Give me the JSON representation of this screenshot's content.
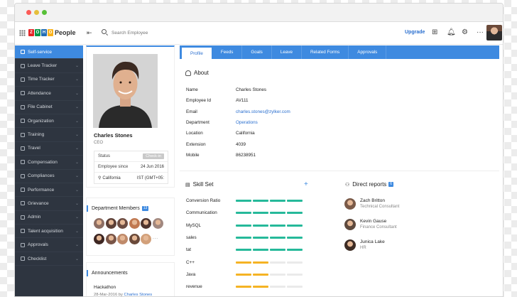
{
  "app": {
    "brand_letters": [
      "Z",
      "O",
      "H",
      "O"
    ],
    "brand_colors": [
      "#e42527",
      "#089949",
      "#226db4",
      "#f9b21d"
    ],
    "brand_word": "People",
    "accent": "#3e8ae0"
  },
  "topbar": {
    "search_placeholder": "Search Employee",
    "upgrade_label": "Upgrade",
    "icons": [
      "add-icon",
      "bell-icon",
      "gear-icon",
      "more-icon"
    ]
  },
  "sidebar": {
    "items": [
      {
        "label": "Self-service",
        "icon": "user-icon"
      },
      {
        "label": "Leave Tracker",
        "icon": "calendar-icon"
      },
      {
        "label": "Time Tracker",
        "icon": "clock-icon"
      },
      {
        "label": "Attendance",
        "icon": "attendance-icon"
      },
      {
        "label": "File Cabinet",
        "icon": "folder-icon"
      },
      {
        "label": "Organization",
        "icon": "org-icon"
      },
      {
        "label": "Training",
        "icon": "training-icon"
      },
      {
        "label": "Travel",
        "icon": "plane-icon"
      },
      {
        "label": "Compensation",
        "icon": "money-icon"
      },
      {
        "label": "Compliances",
        "icon": "shield-icon"
      },
      {
        "label": "Performance",
        "icon": "chart-icon"
      },
      {
        "label": "Grievance",
        "icon": "flag-icon"
      },
      {
        "label": "Admin",
        "icon": "admin-icon"
      },
      {
        "label": "Talent acquisition",
        "icon": "search-person-icon"
      },
      {
        "label": "Approvals",
        "icon": "check-icon"
      },
      {
        "label": "Checklist",
        "icon": "list-icon"
      }
    ]
  },
  "profile": {
    "name": "Charles Stones",
    "role": "CEO",
    "status_label": "Status",
    "checkin_label": "Check-in",
    "employee_since_label": "Employee since",
    "employee_since_value": "24 Jun 2016",
    "location": "California",
    "timezone": "IST (GMT+05:"
  },
  "members": {
    "title": "Department Members",
    "count": "13",
    "more": "···",
    "colors": [
      "#8d6e63",
      "#5d4037",
      "#6d4c41",
      "#c07850",
      "#4e342e",
      "#a1887f",
      "#3e2723",
      "#795548",
      "#bf8a6a",
      "#6a4a3a",
      "#d2a07a"
    ]
  },
  "announcements": {
    "title": "Announcements",
    "item_title": "Hackathon",
    "item_date": "28-Mar-2016 by",
    "item_author": "Charles Stones"
  },
  "tabs": [
    "Profile",
    "Feeds",
    "Goals",
    "Leave",
    "Related Forms",
    "Approvals"
  ],
  "about": {
    "title": "About",
    "rows": [
      {
        "key": "Name",
        "value": "Charles Stones",
        "link": false
      },
      {
        "key": "Employee Id",
        "value": "AV111",
        "link": false
      },
      {
        "key": "Email",
        "value": "charles.stones@zylker.com",
        "link": true
      },
      {
        "key": "Department",
        "value": "Operations",
        "link": true
      },
      {
        "key": "Location",
        "value": "California",
        "link": false
      },
      {
        "key": "Extension",
        "value": "4039",
        "link": false
      },
      {
        "key": "Mobile",
        "value": "86238951",
        "link": false
      }
    ]
  },
  "skills": {
    "title": "Skill Set",
    "add": "+",
    "colors": {
      "high": "#26b99a",
      "mid": "#f5b324",
      "empty": "#eaeaea"
    },
    "items": [
      {
        "name": "Conversion Ratio",
        "level": 4,
        "color": "high"
      },
      {
        "name": "Communication",
        "level": 4,
        "color": "high"
      },
      {
        "name": "MySQL",
        "level": 4,
        "color": "high"
      },
      {
        "name": "sales",
        "level": 4,
        "color": "high"
      },
      {
        "name": "tat",
        "level": 4,
        "color": "high"
      },
      {
        "name": "C++",
        "level": 2,
        "color": "mid"
      },
      {
        "name": "Java",
        "level": 2,
        "color": "mid"
      },
      {
        "name": "revenue",
        "level": 2,
        "color": "mid"
      }
    ]
  },
  "reports": {
    "title": "Direct reports",
    "count": "6",
    "people": [
      {
        "name": "Zach Britton",
        "title": "Technical Consultant",
        "color": "#7a5a48"
      },
      {
        "name": "Kevin Gause",
        "title": "Finance Consultant",
        "color": "#5e4a3e"
      },
      {
        "name": "Junica Lake",
        "title": "HR",
        "color": "#3d2c24"
      }
    ]
  }
}
